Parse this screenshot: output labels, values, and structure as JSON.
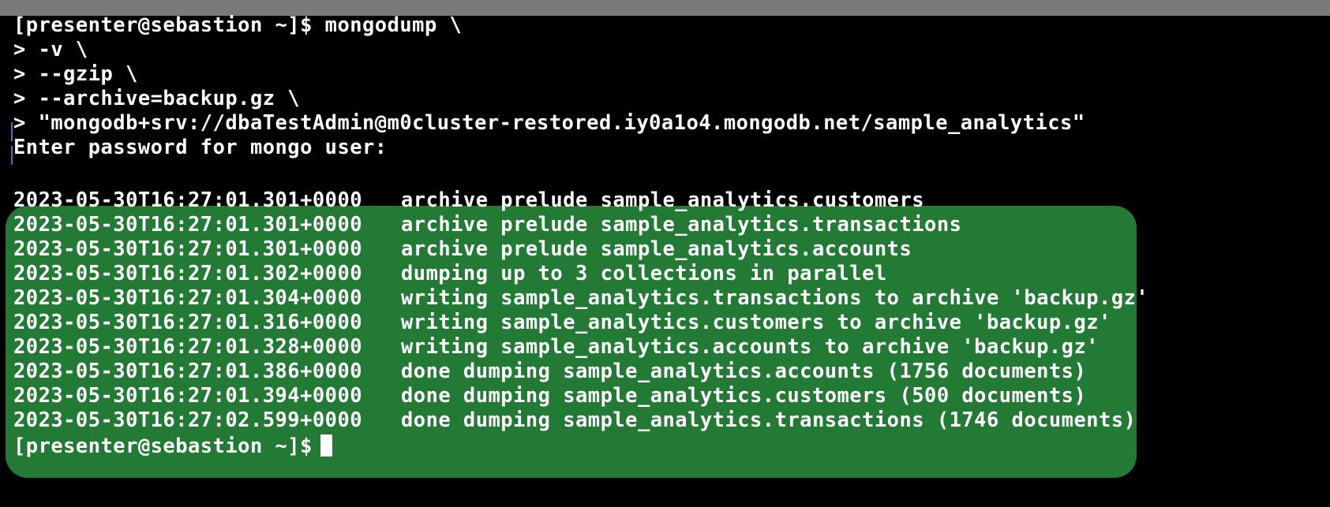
{
  "terminal": {
    "command_lines": [
      "[presenter@sebastion ~]$ mongodump \\",
      "> -v \\",
      "> --gzip \\",
      "> --archive=backup.gz \\",
      "> \"mongodb+srv://dbaTestAdmin@m0cluster-restored.iy0a1o4.mongodb.net/sample_analytics\"",
      "Enter password for mongo user:"
    ],
    "log": [
      {
        "ts": "2023-05-30T16:27:01.301+0000",
        "msg": "archive prelude sample_analytics.customers"
      },
      {
        "ts": "2023-05-30T16:27:01.301+0000",
        "msg": "archive prelude sample_analytics.transactions"
      },
      {
        "ts": "2023-05-30T16:27:01.301+0000",
        "msg": "archive prelude sample_analytics.accounts"
      },
      {
        "ts": "2023-05-30T16:27:01.302+0000",
        "msg": "dumping up to 3 collections in parallel"
      },
      {
        "ts": "2023-05-30T16:27:01.304+0000",
        "msg": "writing sample_analytics.transactions to archive 'backup.gz'"
      },
      {
        "ts": "2023-05-30T16:27:01.316+0000",
        "msg": "writing sample_analytics.customers to archive 'backup.gz'"
      },
      {
        "ts": "2023-05-30T16:27:01.328+0000",
        "msg": "writing sample_analytics.accounts to archive 'backup.gz'"
      },
      {
        "ts": "2023-05-30T16:27:01.386+0000",
        "msg": "done dumping sample_analytics.accounts (1756 documents)"
      },
      {
        "ts": "2023-05-30T16:27:01.394+0000",
        "msg": "done dumping sample_analytics.customers (500 documents)"
      },
      {
        "ts": "2023-05-30T16:27:02.599+0000",
        "msg": "done dumping sample_analytics.transactions (1746 documents)"
      }
    ],
    "final_prompt": "[presenter@sebastion ~]$"
  },
  "colors": {
    "background": "#000000",
    "text": "#ffffff",
    "highlight": "#227a35",
    "title_strip": "#7a7a78"
  }
}
